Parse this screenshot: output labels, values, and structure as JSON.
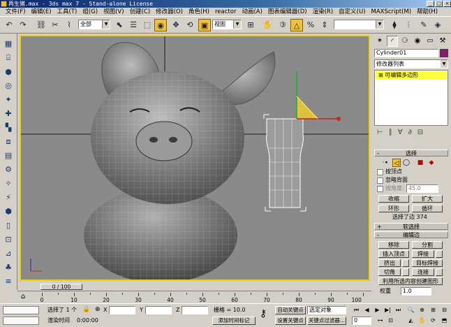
{
  "window": {
    "title": "再生猪.max - 3ds max 7 - Stand-alone License",
    "minimize": "_",
    "maximize": "□",
    "close": "×"
  },
  "menu": [
    "文件(F)",
    "编辑(E)",
    "工具(T)",
    "组(G)",
    "视图(V)",
    "创建(C)",
    "修改器(O)",
    "角色(H)",
    "reactor",
    "动画(A)",
    "图表编辑器(D)",
    "渲染(R)",
    "自定义(U)",
    "MAXScript(M)",
    "帮助(H)"
  ],
  "toolbar": {
    "selection_filter": "全部",
    "ref_coord": "视图",
    "named_selection": ""
  },
  "command_panel": {
    "object_name": "Cylinder01",
    "object_color": "#8a1a7a",
    "modifier_list": "修改器列表",
    "stack_item": "可编辑多边形",
    "selection": {
      "title": "选择",
      "by_vertex": "按顶点",
      "ignore_backfacing": "忽略背面",
      "by_angle": "按角度:",
      "angle_value": "45.0",
      "shrink": "收缩",
      "grow": "扩大",
      "ring": "环形",
      "loop": "循环",
      "selected_info": "选择了边 374"
    },
    "soft_selection": {
      "title": "软选择"
    },
    "edit_edges": {
      "title": "编辑边",
      "remove": "移除",
      "split": "分割",
      "insert_vertex": "插入顶点",
      "weld": "焊接",
      "extrude": "挤出",
      "target_weld": "目标焊接",
      "chamfer": "切角",
      "connect": "连接",
      "create_shape": "利用所选内容创建图形",
      "weight_label": "权重",
      "weight_value": "1.0"
    }
  },
  "timeline": {
    "slider": "0 / 100",
    "ticks": [
      "0",
      "10",
      "20",
      "30",
      "40",
      "50",
      "60",
      "70",
      "80",
      "90",
      "100"
    ]
  },
  "status": {
    "selected": "选择了 1 个",
    "x_label": "X",
    "y_label": "Y",
    "z_label": "Z",
    "grid": "栅格 = 10.0",
    "add_time_tag": "添加时间标记",
    "render_time": "渲染时间",
    "render_time_value": "0:00:00",
    "auto_key": "自动关键点",
    "set_key": "设置关键点",
    "selected_object": "选定对象",
    "key_filters": "关键点过滤器...",
    "frame": "0"
  }
}
